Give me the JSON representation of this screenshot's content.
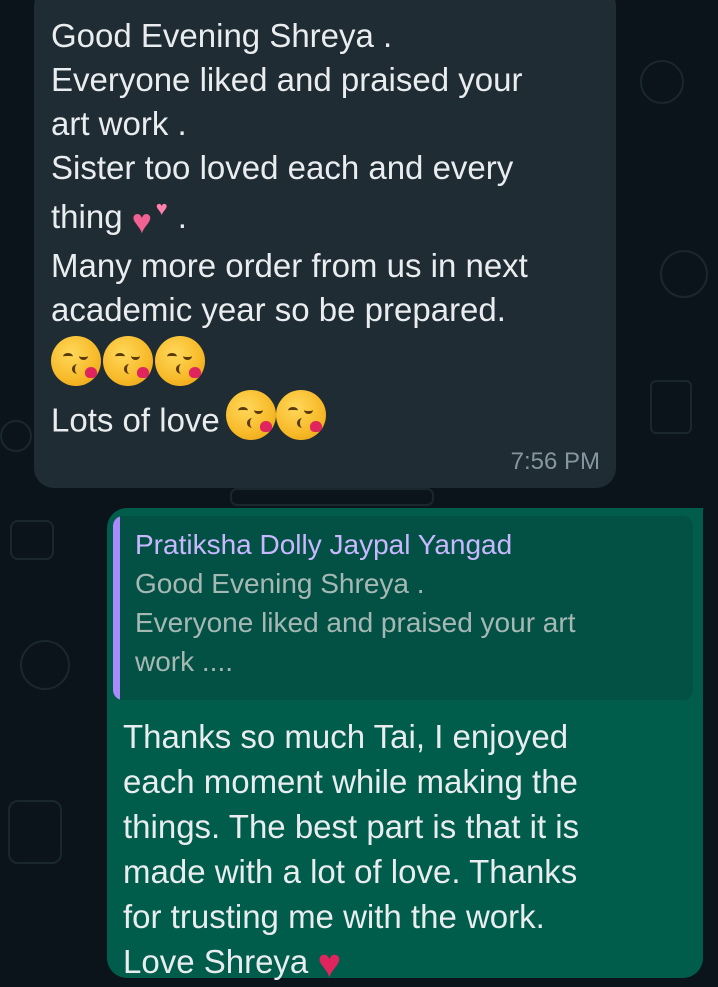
{
  "incoming_message": {
    "lines": [
      "Good Evening  Shreya .",
      "Everyone liked and praised your",
      "art work .",
      "Sister too loved each and every",
      "thing",
      ".",
      "Many more order from us in next",
      "academic year so be prepared.",
      "Lots of love"
    ],
    "time": "7:56 PM",
    "emojis": {
      "heart_emoji": "two-hearts-icon",
      "kiss_emoji": "face-blowing-kiss-icon",
      "kiss_row_count": 3,
      "inline_kiss_count": 2
    }
  },
  "outgoing_message": {
    "quoted": {
      "author": "Pratiksha Dolly Jaypal Yangad",
      "lines": [
        "Good Evening  Shreya .",
        "Everyone liked and praised your art",
        "work ...."
      ]
    },
    "lines": [
      "Thanks so much Tai, I enjoyed",
      "each moment while making the",
      "things. The best part is that it is",
      "made with a lot of love. Thanks",
      "for trusting me with the work.",
      "Love Shreya"
    ],
    "sign_emoji": "red-heart-icon"
  },
  "colors": {
    "background": "#0b141a",
    "incoming_bubble": "#202c33",
    "outgoing_bubble": "#005c4b",
    "quote_bar": "#a78bfa",
    "timestamp": "#8696a0"
  }
}
